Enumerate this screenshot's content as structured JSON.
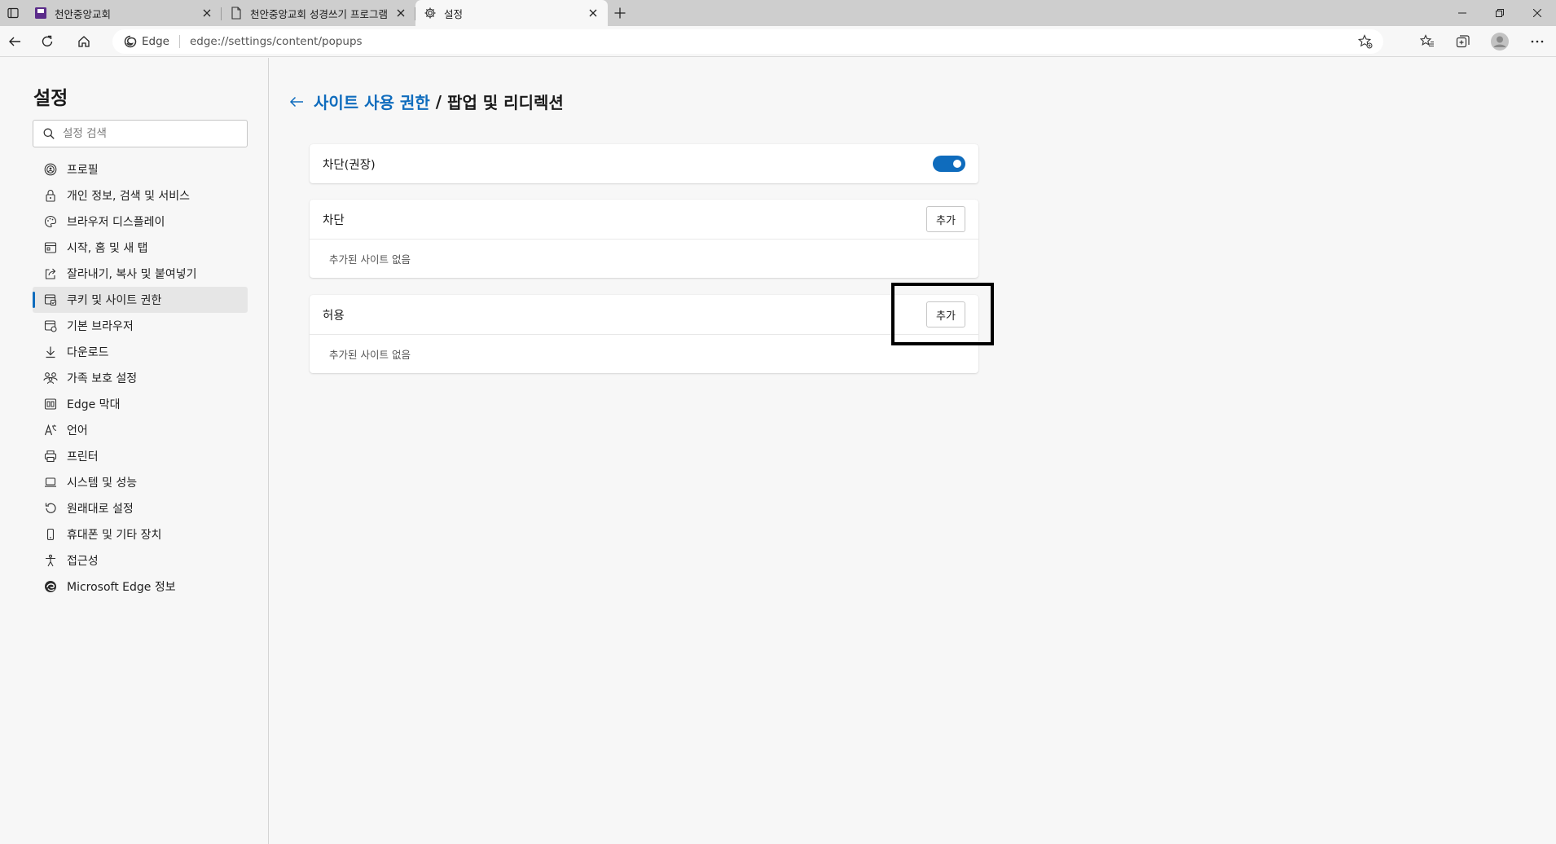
{
  "browser": {
    "tabs": [
      {
        "title": "천안중앙교회",
        "icon": "site-favicon-purple",
        "active": false
      },
      {
        "title": "천안중앙교회 성경쓰기 프로그램",
        "icon": "document-icon",
        "active": false
      },
      {
        "title": "설정",
        "icon": "gear-icon",
        "active": true
      }
    ],
    "address": {
      "chip_label": "Edge",
      "url": "edge://settings/content/popups"
    },
    "accent": "#0f6cbd"
  },
  "sidebar": {
    "title": "설정",
    "search_placeholder": "설정 검색",
    "items": [
      {
        "label": "프로필",
        "icon": "profile-icon"
      },
      {
        "label": "개인 정보, 검색 및 서비스",
        "icon": "lock-icon"
      },
      {
        "label": "브라우저 디스플레이",
        "icon": "palette-icon"
      },
      {
        "label": "시작, 홈 및 새 탭",
        "icon": "home-tab-icon"
      },
      {
        "label": "잘라내기, 복사 및 붙여넣기",
        "icon": "share-icon"
      },
      {
        "label": "쿠키 및 사이트 권한",
        "icon": "cookie-permissions-icon",
        "selected": true
      },
      {
        "label": "기본 브라우저",
        "icon": "browser-icon"
      },
      {
        "label": "다운로드",
        "icon": "download-icon"
      },
      {
        "label": "가족 보호 설정",
        "icon": "family-icon"
      },
      {
        "label": "Edge 막대",
        "icon": "edge-bar-icon"
      },
      {
        "label": "언어",
        "icon": "language-icon"
      },
      {
        "label": "프린터",
        "icon": "printer-icon"
      },
      {
        "label": "시스템 및 성능",
        "icon": "laptop-icon"
      },
      {
        "label": "원래대로 설정",
        "icon": "reset-icon"
      },
      {
        "label": "휴대폰 및 기타 장치",
        "icon": "phone-icon"
      },
      {
        "label": "접근성",
        "icon": "accessibility-icon"
      },
      {
        "label": "Microsoft Edge 정보",
        "icon": "edge-logo-icon"
      }
    ]
  },
  "main": {
    "breadcrumb_link": "사이트 사용 권한",
    "breadcrumb_sep": "/",
    "breadcrumb_current": "팝업 및 리디렉션",
    "block_toggle": {
      "label": "차단(권장)",
      "on": true
    },
    "block_section": {
      "title": "차단",
      "add_label": "추가",
      "empty_text": "추가된 사이트 없음"
    },
    "allow_section": {
      "title": "허용",
      "add_label": "추가",
      "empty_text": "추가된 사이트 없음"
    }
  }
}
